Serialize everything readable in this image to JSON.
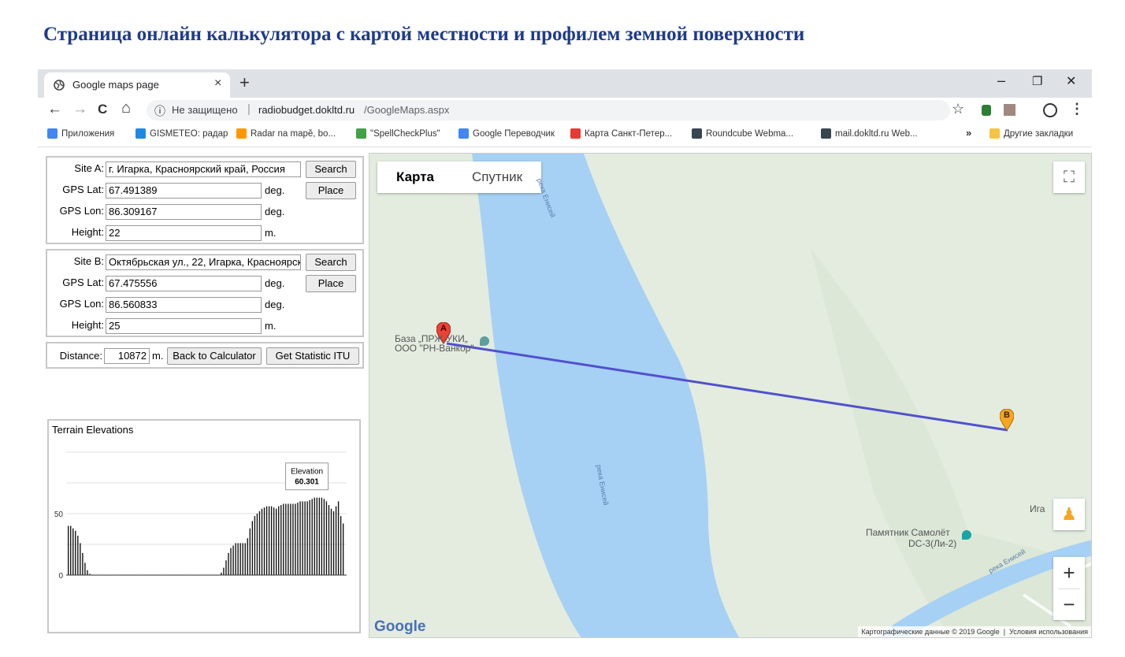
{
  "caption": "Страница онлайн калькулятора с картой местности и профилем земной поверхности",
  "browser": {
    "tab_title": "Google maps page",
    "tab_close": "×",
    "new_tab": "+",
    "win_min": "–",
    "win_max": "❐",
    "win_close": "✕",
    "nav_back": "←",
    "nav_forward": "→",
    "nav_reload": "C",
    "nav_home": "⌂",
    "info_icon": "ⓘ",
    "insecure": "Не защищено",
    "separator": "|",
    "url_host": "radiobudget.dokltd.ru",
    "url_path": "/GoogleMaps.aspx",
    "star": "☆",
    "menu": "⋮",
    "bookmarks": [
      {
        "label": "Приложения",
        "color": "#4285f4"
      },
      {
        "label": "GISMETEO: радар",
        "color": "#1e88e5"
      },
      {
        "label": "Radar na mapě, bo...",
        "color": "#ff9800"
      },
      {
        "label": "\"SpellCheckPlus\"",
        "color": "#43a047"
      },
      {
        "label": "Google Переводчик",
        "color": "#4285f4"
      },
      {
        "label": "Карта Санкт-Петер...",
        "color": "#e53935"
      },
      {
        "label": "Roundcube Webma...",
        "color": "#37474f"
      },
      {
        "label": "mail.dokltd.ru Web...",
        "color": "#37474f"
      }
    ],
    "bookmarks_more": "»",
    "other_bookmarks": "Другие закладки"
  },
  "calculator": {
    "site_a": {
      "label": "Site A:",
      "address": "г. Игарка, Красноярский край, Россия",
      "lat_label": "GPS Lat:",
      "lat": "67.491389",
      "lon_label": "GPS Lon:",
      "lon": "86.309167",
      "height_label": "Height:",
      "height": "22"
    },
    "site_b": {
      "label": "Site B:",
      "address": "Октябрьская ул., 22, Игарка, Красноярск",
      "lat_label": "GPS Lat:",
      "lat": "67.475556",
      "lon_label": "GPS Lon:",
      "lon": "86.560833",
      "height_label": "Height:",
      "height": "25"
    },
    "unit_deg": "deg.",
    "unit_m": "m.",
    "search_label": "Search",
    "place_label": "Place",
    "distance_label": "Distance:",
    "distance_value": "10872",
    "back_label": "Back to Calculator",
    "stat_label": "Get Statistic ITU"
  },
  "chart_data": {
    "type": "bar",
    "title": "Terrain Elevations",
    "xlabel": "",
    "ylabel": "",
    "ylim": [
      0,
      100
    ],
    "yticks": [
      0,
      50
    ],
    "grid": true,
    "tooltip": {
      "label": "Elevation",
      "value": "60.301"
    },
    "values": [
      40,
      40,
      38,
      36,
      32,
      26,
      18,
      10,
      4,
      1,
      0,
      0,
      0,
      0,
      0,
      0,
      0,
      0,
      0,
      0,
      0,
      0,
      0,
      0,
      0,
      0,
      0,
      0,
      0,
      0,
      0,
      0,
      0,
      0,
      0,
      0,
      0,
      0,
      0,
      0,
      0,
      0,
      0,
      0,
      0,
      0,
      0,
      0,
      0,
      0,
      0,
      0,
      0,
      0,
      0,
      0,
      0,
      0,
      0,
      0,
      0,
      0,
      0,
      0,
      2,
      6,
      12,
      18,
      22,
      24,
      26,
      26,
      26,
      26,
      26,
      30,
      38,
      44,
      48,
      50,
      52,
      54,
      55,
      56,
      56,
      56,
      55,
      54,
      56,
      57,
      58,
      58,
      58,
      58,
      58,
      58,
      59,
      60,
      60,
      60,
      60,
      61,
      62,
      63,
      63,
      63,
      63,
      62,
      60,
      57,
      54,
      52,
      56,
      60,
      48,
      42
    ]
  },
  "map": {
    "btn_map": "Карта",
    "btn_satellite": "Спутник",
    "fullscreen_icon": "⛶",
    "zoom_in": "+",
    "zoom_out": "−",
    "pegman_icon": "♟",
    "marker_a": "A",
    "marker_b": "B",
    "poi_base_1": "База „ПРЖ-УКИ„",
    "poi_base_2": "ООО \"РН-Ванкор\"",
    "poi_monument_1": "Памятник Самолёт",
    "poi_monument_2": "DC-3(Ли-2)",
    "river_label_top": "река Енисей",
    "river_label_mid": "река Енисей",
    "river_label_bottom": "река Енисей",
    "town_label": "Ига",
    "logo": "Google",
    "footer_data": "Картографические данные © 2019 Google",
    "footer_terms": "Условия использования"
  }
}
